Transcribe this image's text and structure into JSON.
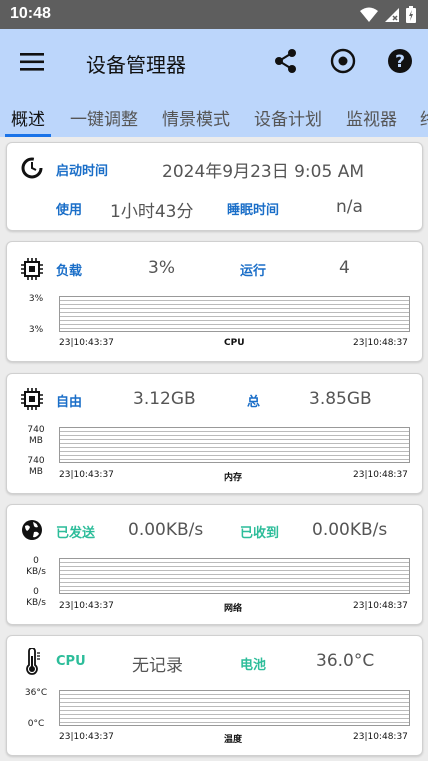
{
  "status": {
    "time": "10:48"
  },
  "appbar": {
    "title": "设备管理器"
  },
  "tabs": [
    "概述",
    "一键调整",
    "情景模式",
    "设备计划",
    "监视器",
    "终"
  ],
  "uptime": {
    "start_label": "启动时间",
    "start_value": "2024年9月23日 9:05 AM",
    "use_label": "使用",
    "use_value": "1小时43分",
    "sleep_label": "睡眠时间",
    "sleep_value": "n/a"
  },
  "cpu": {
    "load_label": "负载",
    "load_value": "3%",
    "run_label": "运行",
    "run_value": "4",
    "axis_top": "3%",
    "axis_bottom": "3%",
    "t_start": "23|10:43:37",
    "t_end": "23|10:48:37",
    "name": "CPU"
  },
  "memory": {
    "free_label": "自由",
    "free_value": "3.12GB",
    "total_label": "总",
    "total_value": "3.85GB",
    "axis_top": "740\nMB",
    "axis_bottom": "740\nMB",
    "t_start": "23|10:43:37",
    "t_end": "23|10:48:37",
    "name": "内存"
  },
  "network": {
    "sent_label": "已发送",
    "sent_value": "0.00KB/s",
    "recv_label": "已收到",
    "recv_value": "0.00KB/s",
    "axis_top": "0\nKB/s",
    "axis_bottom": "0\nKB/s",
    "t_start": "23|10:43:37",
    "t_end": "23|10:48:37",
    "name": "网络"
  },
  "temperature": {
    "cpu_label": "CPU",
    "cpu_value": "无记录",
    "battery_label": "电池",
    "battery_value": "36.0°C",
    "axis_top": "36°C",
    "axis_bottom": "0°C",
    "t_start": "23|10:43:37",
    "t_end": "23|10:48:37",
    "name": "温度"
  },
  "icons": {
    "menu": "hamburger-menu-icon",
    "share": "share-icon",
    "record": "record-icon",
    "help": "help-icon",
    "uptime": "clock-ring-icon",
    "cpu": "chip-icon",
    "memory": "memory-chip-icon",
    "network": "globe-icon",
    "temperature": "thermometer-icon"
  },
  "colors": {
    "appbar": "#bcd6fb",
    "accent": "#1a73e8",
    "label_blue": "#1a6ec8",
    "label_green": "#2dbd9a",
    "statusbar": "#5e5e5e"
  }
}
